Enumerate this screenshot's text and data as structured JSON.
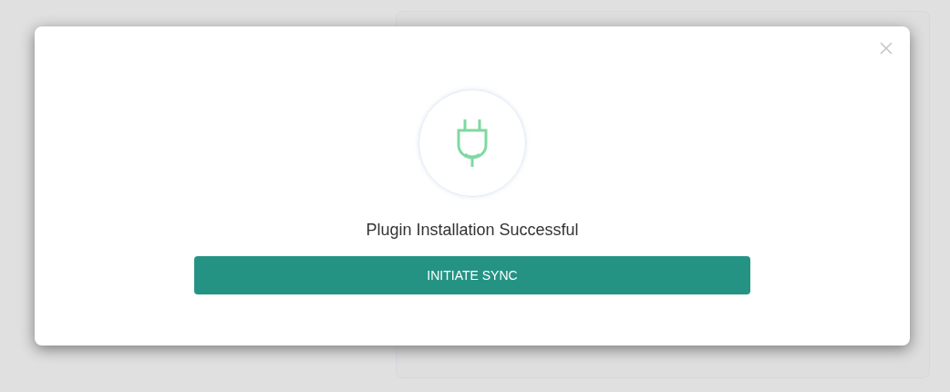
{
  "dialog": {
    "message": "Plugin Installation Successful",
    "button": "INITIATE SYNC"
  }
}
